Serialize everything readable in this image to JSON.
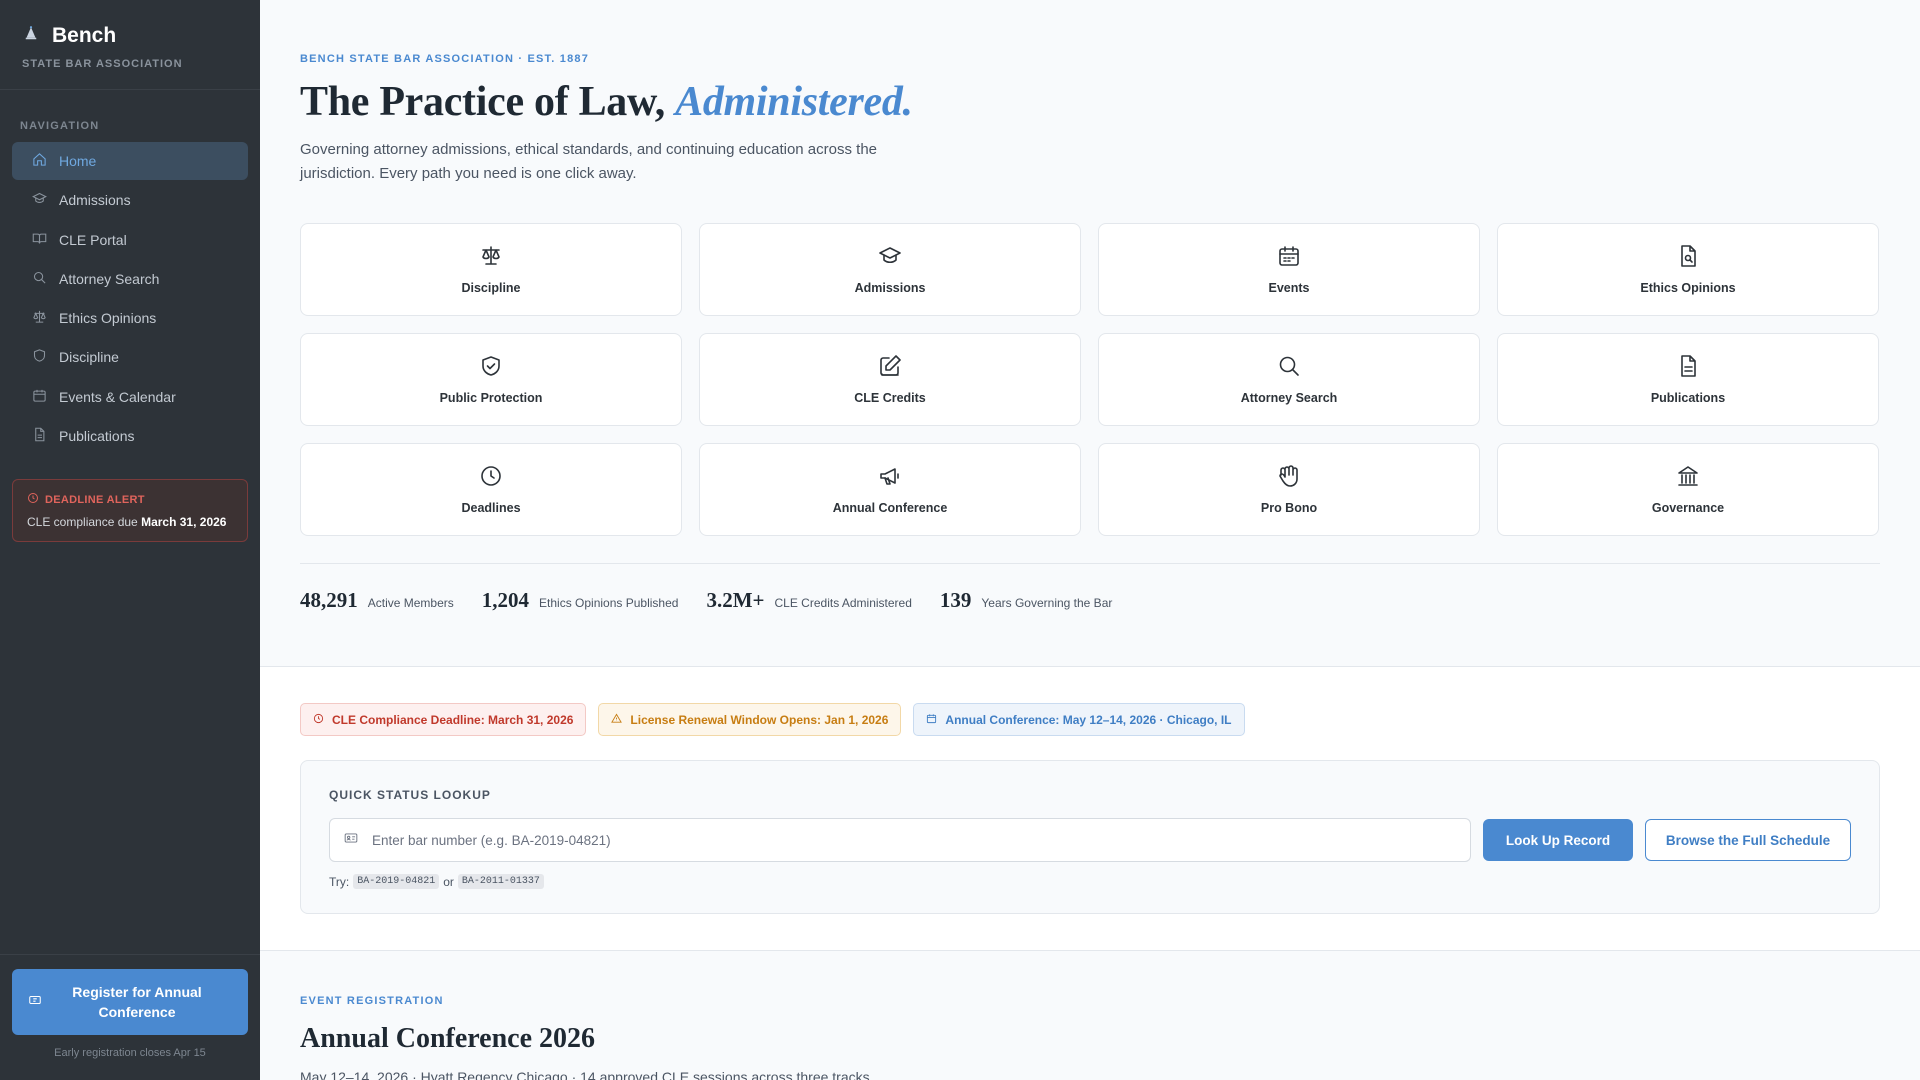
{
  "sidebar": {
    "brand": "Bench",
    "brand_sub": "STATE BAR ASSOCIATION",
    "nav_heading": "NAVIGATION",
    "items": [
      {
        "label": "Home",
        "icon": "home-icon",
        "active": true
      },
      {
        "label": "Admissions",
        "icon": "graduation-cap-icon"
      },
      {
        "label": "CLE Portal",
        "icon": "book-open-icon"
      },
      {
        "label": "Attorney Search",
        "icon": "search-icon"
      },
      {
        "label": "Ethics Opinions",
        "icon": "scale-icon"
      },
      {
        "label": "Discipline",
        "icon": "shield-icon"
      },
      {
        "label": "Events & Calendar",
        "icon": "calendar-icon"
      },
      {
        "label": "Publications",
        "icon": "document-icon"
      }
    ],
    "alert": {
      "title": "DEADLINE ALERT",
      "text": "CLE compliance due",
      "date": "March 31, 2026"
    },
    "register_button": "Register for Annual Conference",
    "register_note": "Early registration closes Apr 15"
  },
  "hero": {
    "eyebrow": "BENCH STATE BAR ASSOCIATION · EST. 1887",
    "title_main": "The Practice of Law, ",
    "title_accent": "Administered.",
    "lede": "Governing attorney admissions, ethical standards, and continuing education across the jurisdiction. Every path you need is one click away."
  },
  "tiles": [
    {
      "label": "Discipline",
      "icon": "scale-icon"
    },
    {
      "label": "Admissions",
      "icon": "graduation-cap-icon"
    },
    {
      "label": "Events",
      "icon": "calendar-icon"
    },
    {
      "label": "Ethics Opinions",
      "icon": "document-search-icon"
    },
    {
      "label": "Public Protection",
      "icon": "shield-check-icon"
    },
    {
      "label": "CLE Credits",
      "icon": "pencil-icon"
    },
    {
      "label": "Attorney Search",
      "icon": "search-icon"
    },
    {
      "label": "Publications",
      "icon": "document-icon"
    },
    {
      "label": "Deadlines",
      "icon": "clock-icon"
    },
    {
      "label": "Annual Conference",
      "icon": "megaphone-icon"
    },
    {
      "label": "Pro Bono",
      "icon": "hand-icon"
    },
    {
      "label": "Governance",
      "icon": "building-icon"
    }
  ],
  "stats": [
    {
      "value": "48,291",
      "label": "Active Members"
    },
    {
      "value": "1,204",
      "label": "Ethics Opinions Published"
    },
    {
      "value": "3.2M+",
      "label": "CLE Credits Administered"
    },
    {
      "value": "139",
      "label": "Years Governing the Bar"
    }
  ],
  "notices": [
    {
      "text": "CLE Compliance Deadline: March 31, 2026",
      "tone": "red",
      "icon": "clock-icon"
    },
    {
      "text": "License Renewal Window Opens: Jan 1, 2026",
      "tone": "amber",
      "icon": "warning-icon"
    },
    {
      "text": "Annual Conference: May 12–14, 2026 · Chicago, IL",
      "tone": "blue",
      "icon": "calendar-icon"
    }
  ],
  "lookup": {
    "title": "QUICK STATUS LOOKUP",
    "placeholder": "Enter bar number (e.g. BA-2019-04821)",
    "primary_button": "Look Up Record",
    "secondary_button": "Browse the Full Schedule",
    "try_label": "Try:",
    "examples": [
      "BA-2019-04821",
      "BA-2011-01337"
    ],
    "or_text": "or"
  },
  "event": {
    "eyebrow": "EVENT REGISTRATION",
    "title": "Annual Conference 2026",
    "subtitle": "May 12–14, 2026 · Hyatt Regency Chicago · 14 approved CLE sessions across three tracks"
  }
}
